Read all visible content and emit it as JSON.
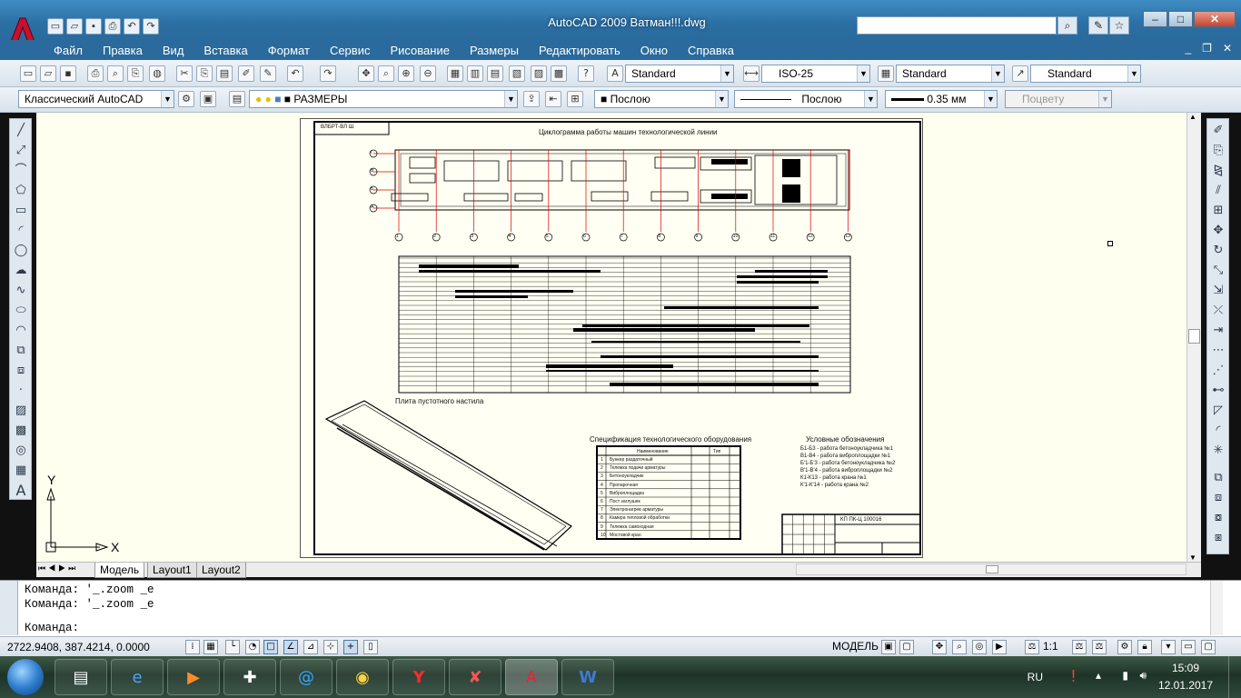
{
  "window": {
    "title": "AutoCAD 2009 Ватман!!!.dwg"
  },
  "menu": [
    "Файл",
    "Правка",
    "Вид",
    "Вставка",
    "Формат",
    "Сервис",
    "Рисование",
    "Размеры",
    "Редактировать",
    "Окно",
    "Справка"
  ],
  "toolbar": {
    "text_style": "Standard",
    "dim_style": "ISO-25",
    "table_style": "Standard",
    "multileader_style": "Standard",
    "workspace": "Классический AutoCAD",
    "layer": "РАЗМЕРЫ",
    "color": "Послою",
    "linetype": "Послою",
    "lineweight": "0.35 мм",
    "plotstyle": "Поцвету"
  },
  "drawing": {
    "stamp_top": "ВЛБРТ-ВЛ Ш",
    "title_cyclogram": "Циклограмма работы машин технологической линии",
    "title_slab": "Плита пустотного настила",
    "title_spec": "Спецификация технологического оборудования",
    "spec_header_name": "Наименование",
    "spec_header_type": "Тип",
    "spec_rows": [
      "Бункер раздаточный",
      "Тележка подачи арматуры",
      "Бетоноукладчик",
      "Пропарочная",
      "Виброплощадка",
      "Пост заглушек",
      "Электронагрев арматуры",
      "Камера тепловой обработки",
      "Тележка самоходная",
      "Мостовой кран"
    ],
    "legend_title": "Условные обозначения",
    "legend_items": [
      "Б1-Б3 - работа бетоноукладчика №1",
      "В1-В4 - работа виброплощадки №1",
      "Б'1-Б'3 - работа бетоноукладчика №2",
      "В'1-В'4 - работа виброплощадки №2",
      "К1-К13 - работа крана №1",
      "К'1-К'14 - работа крана №2"
    ],
    "stamp_code": "КП ПК-Ц 100016",
    "axis_numbers": [
      "1",
      "2",
      "3",
      "4",
      "5",
      "6",
      "7",
      "8",
      "9",
      "10",
      "11",
      "12",
      "13"
    ],
    "row_labels": [
      "Г",
      "В",
      "Б",
      "А"
    ]
  },
  "layout_tabs": [
    "Модель",
    "Layout1",
    "Layout2"
  ],
  "command": {
    "history": [
      "Команда: '_.zoom _e",
      "Команда: '_.zoom _e"
    ],
    "prompt": "Команда:"
  },
  "status": {
    "coordinates": "2722.9408, 387.4214, 0.0000",
    "model_label": "МОДЕЛЬ",
    "scale": "1:1"
  },
  "tray": {
    "language": "RU",
    "time": "15:09",
    "date": "12.01.2017"
  },
  "ucs": {
    "x": "X",
    "y": "Y"
  }
}
